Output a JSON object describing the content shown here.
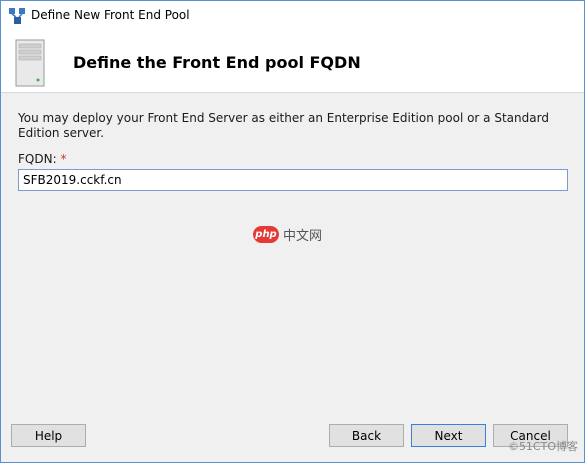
{
  "window": {
    "title": "Define New Front End Pool",
    "title_icon": "topology-builder-icon"
  },
  "header": {
    "title": "Define the Front End pool FQDN",
    "icon": "server-icon"
  },
  "content": {
    "description": "You may deploy your Front End Server as either an Enterprise Edition pool or a Standard Edition server.",
    "fqdn_label": "FQDN:",
    "required_marker": "*",
    "fqdn_value": "SFB2019.cckf.cn"
  },
  "watermark": {
    "logo": "php",
    "text": "中文网"
  },
  "footer": {
    "help_label": "Help",
    "back_label": "Back",
    "next_label": "Next",
    "cancel_label": "Cancel"
  },
  "corner_watermark": "©51CTO博客",
  "colors": {
    "accent": "#3c7fd8",
    "required": "#c0392b"
  }
}
